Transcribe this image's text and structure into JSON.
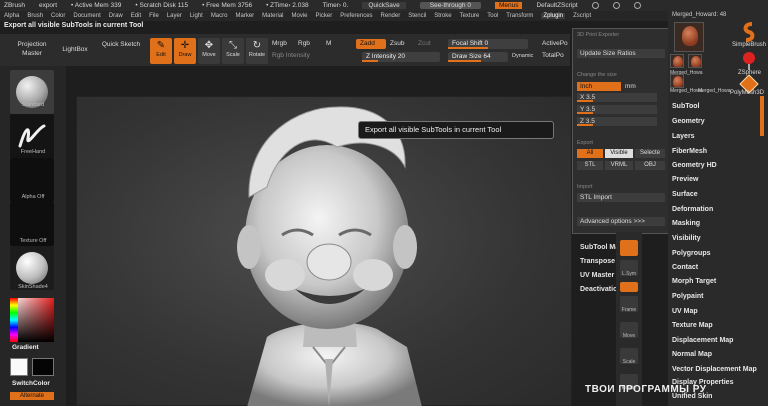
{
  "titlebar": {
    "app": "ZBrush",
    "project": "export",
    "active_mem": "• Active Mem 339",
    "scratch": "• Scratch Disk 115",
    "free_mem": "• Free Mem 3756",
    "ztime": "• ZTime› 2.038",
    "timer": "Timer› 0.",
    "quicksave": "QuickSave",
    "seethrough": "See-through  0",
    "menus": "Menus",
    "script": "DefaultZScript"
  },
  "menubar": [
    "Alpha",
    "Brush",
    "Color",
    "Document",
    "Draw",
    "Edit",
    "File",
    "Layer",
    "Light",
    "Macro",
    "Marker",
    "Material",
    "Movie",
    "Picker",
    "Preferences",
    "Render",
    "Stencil",
    "Stroke",
    "Texture",
    "Tool",
    "Transform",
    "Zplugin",
    "Zscript"
  ],
  "menubar_active": "Zplugin",
  "status_tip": "Export all visible SubTools in current Tool",
  "shelf": {
    "projection_master": "Projection Master",
    "lightbox": "LightBox",
    "quick_sketch": "Quick Sketch",
    "edit": "Edit",
    "draw": "Draw",
    "move": "Move",
    "scale": "Scale",
    "rotate": "Rotate",
    "mrgb": "Mrgb",
    "rgb": "Rgb",
    "m": "M",
    "rgb_intensity": "Rgb Intensity",
    "zadd": "Zadd",
    "zsub": "Zsub",
    "zcut": "Zcut",
    "z_intensity": "Z Intensity 20",
    "focal_shift": "Focal Shift 0",
    "draw_size": "Draw Size 64",
    "dynamic": "Dynamic",
    "active_points": "ActivePo",
    "total_points": "TotalPo"
  },
  "leftpanel": {
    "brush_name": "Standard",
    "stroke_name": "FreeHand",
    "alpha_name": "Alpha Off",
    "texture_name": "Texture Off",
    "material_name": "SkinShade4",
    "gradient": "Gradient",
    "switch_color": "SwitchColor",
    "alternate": "Alternate"
  },
  "tooltip": "Export all visible SubTools in current Tool",
  "dropdown": {
    "item1": "3D Print Exporter",
    "item2": "Update Size Ratios",
    "change_size_header": "Change the size",
    "inch": "Inch",
    "mm": "mm",
    "x": "X 3.5",
    "y": "Y 3.5",
    "z": "Z 3.5",
    "export_header": "Export",
    "all": "All",
    "visible": "Visible",
    "selected": "Selecte",
    "stl": "STL",
    "vrml": "VRML",
    "obj": "OBJ",
    "import_header": "Import",
    "stl_import": "STL Import",
    "advanced": "Advanced options >>>"
  },
  "subtool_panel": {
    "subtool_master": "SubTool Master",
    "transpose_master": "Transpose Master",
    "uv_master": "UV Master",
    "deactivation": "Deactivation"
  },
  "icon_column": [
    "L.Sym",
    "Frame",
    "Move",
    "Scale",
    "Rotate"
  ],
  "right_palette": {
    "thumb_top": "Merged_Howard: 48",
    "thumb_left1": "Merged_Howa",
    "thumb_left2": "Merged_Howa",
    "thumb_left3": "Merged_Howa",
    "simple_brush": "SimpleBrush",
    "zspheres": "ZSphere",
    "polymesh": "PolyMesh3D",
    "items": [
      "SubTool",
      "Geometry",
      "Layers",
      "FiberMesh",
      "Geometry HD",
      "Preview",
      "Surface",
      "Deformation",
      "Masking",
      "Visibility",
      "Polygroups",
      "Contact",
      "Morph Target",
      "Polypaint",
      "UV Map",
      "Texture Map",
      "Displacement Map",
      "Normal Map",
      "Vector Displacement Map",
      "Display Properties",
      "Unified Skin"
    ]
  },
  "watermark": "ТВОИ ПРОГРАММЫ РУ",
  "colors": {
    "accent": "#e0701a",
    "bg": "#2a2a2a"
  }
}
